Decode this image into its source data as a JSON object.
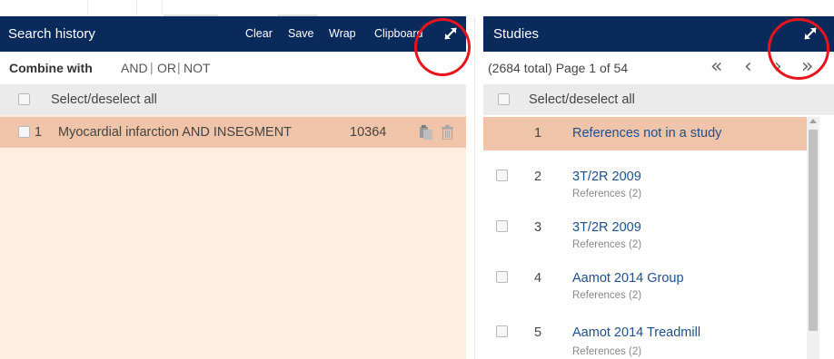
{
  "search_history": {
    "title": "Search history",
    "buttons": {
      "clear": "Clear",
      "save": "Save",
      "wrap": "Wrap",
      "clipboard": "Clipboard"
    },
    "combine": {
      "label": "Combine with",
      "and": "AND",
      "or": "OR",
      "not": "NOT",
      "separator": "|"
    },
    "select_all": "Select/deselect all",
    "rows": [
      {
        "number": "1",
        "query": "Myocardial infarction AND INSEGMENT",
        "count": "10364"
      }
    ]
  },
  "studies": {
    "title": "Studies",
    "pager": {
      "text": "(2684 total) Page 1 of 54",
      "first": "«",
      "prev": "‹",
      "next": "›",
      "last": "»"
    },
    "select_all": "Select/deselect all",
    "rows": [
      {
        "number": "1",
        "name": "References not in a study",
        "sub": ""
      },
      {
        "number": "2",
        "name": "3T/2R 2009",
        "sub": "References (2)"
      },
      {
        "number": "3",
        "name": "3T/2R 2009",
        "sub": "References (2)"
      },
      {
        "number": "4",
        "name": "Aamot 2014 Group",
        "sub": "References (2)"
      },
      {
        "number": "5",
        "name": "Aamot 2014 Treadmill",
        "sub": "References (2)"
      }
    ]
  },
  "colors": {
    "header_bg": "#0a2a5c",
    "highlight_row": "#f0c4a8",
    "left_panel_bg": "#ffeee0",
    "link": "#1f4e8c",
    "annotation": "#e8141c"
  },
  "icons": [
    "expand-icon",
    "copy-icon",
    "trash-icon",
    "checkbox"
  ]
}
